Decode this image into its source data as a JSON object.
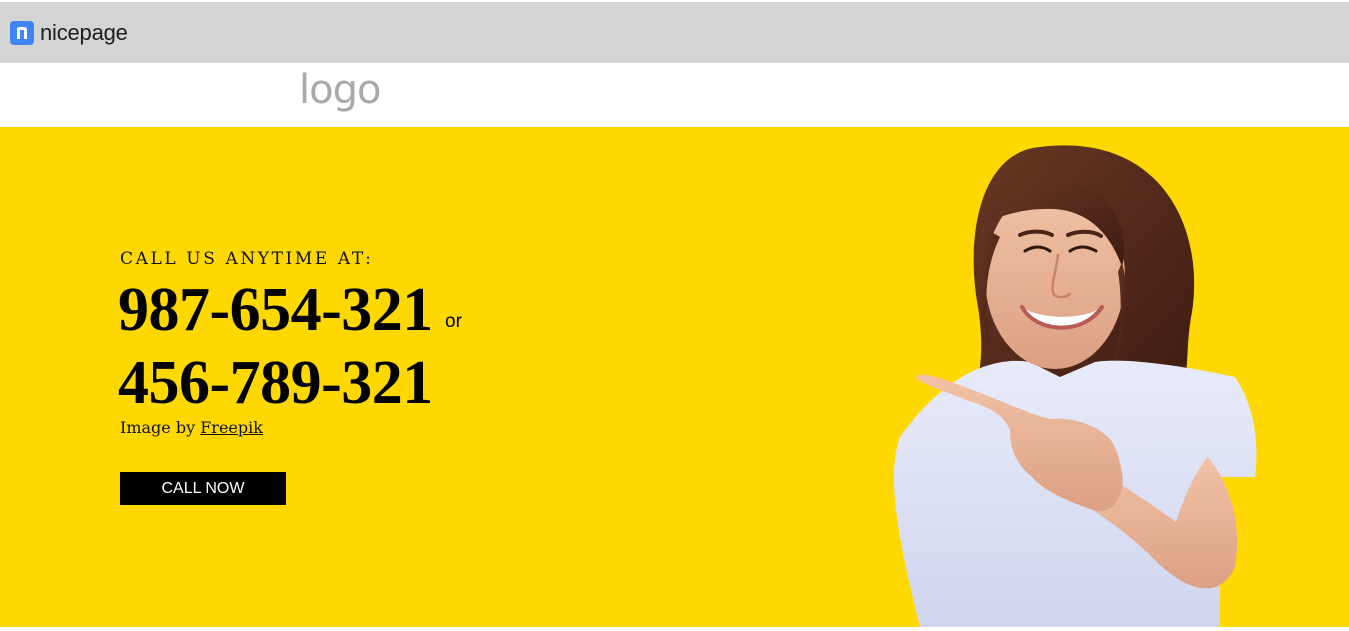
{
  "builder_bar": {
    "brand_name": "nicepage",
    "brand_icon": "nicepage-n-icon",
    "background": "#d4d4d4",
    "accent": "#3f86f5"
  },
  "header": {
    "logo_text": "logo"
  },
  "hero": {
    "background": "#ffd800",
    "eyebrow": "CALL US ANYTIME AT:",
    "phone_primary": "987-654-321",
    "or_text": "or",
    "phone_secondary": "456-789-321",
    "credit_prefix": "Image by",
    "credit_link": "Freepik",
    "cta_label": "CALL NOW"
  }
}
